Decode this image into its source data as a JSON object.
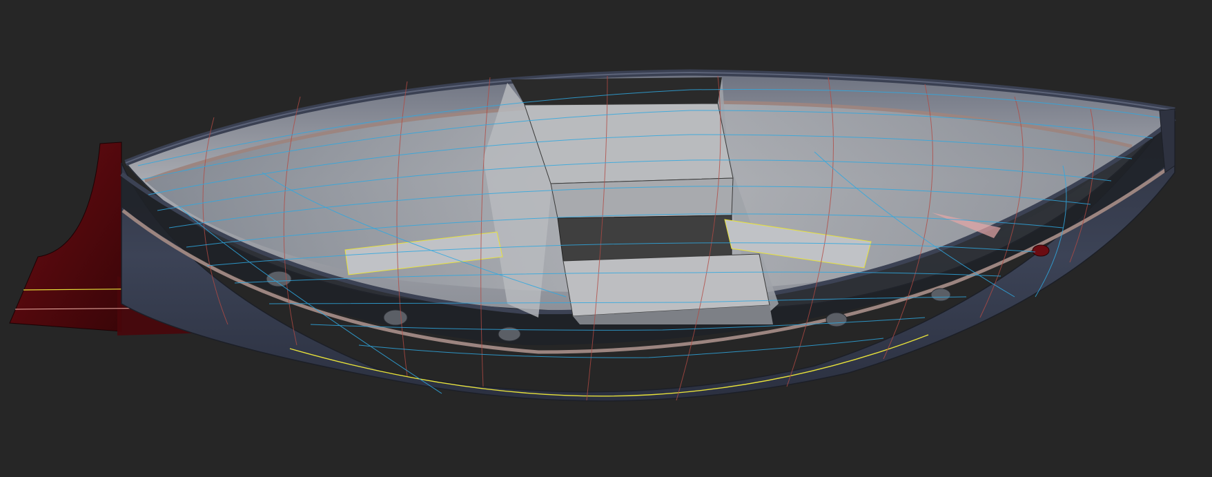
{
  "viewport": {
    "background": "#262626",
    "view": "perspective",
    "render_mode": "shaded-transparent"
  },
  "model": {
    "type": "boat-hull",
    "colors": {
      "hull": "#3b4252",
      "hull_inner": "#8a8f98",
      "deck_interior": "#b4b6ba",
      "cabin_light": "#bdbdbd",
      "cabin_dark": "#2a2a2a",
      "rubrail": "#9c8580",
      "keel_rudder": "#5a0a0e",
      "station_lines": "#c0504d",
      "waterlines": "#2fa8e0",
      "highlight_curve": "#e8e23a"
    },
    "portholes": 6
  }
}
